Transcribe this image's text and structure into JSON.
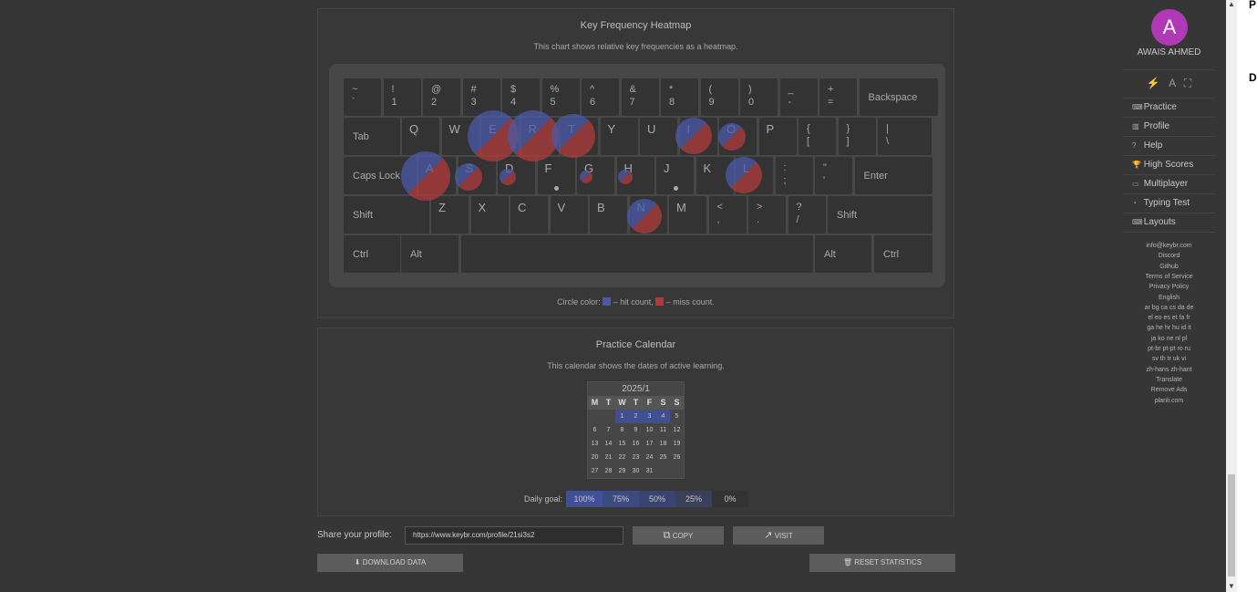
{
  "heatmap": {
    "title": "Key Frequency Heatmap",
    "description": "This chart shows relative key frequencies as a heatmap.",
    "legend_prefix": "Circle color:",
    "legend_hit": "– hit count,",
    "legend_miss": "– miss count.",
    "hit_color": "#4a5aa8",
    "miss_color": "#b03a3a"
  },
  "keyboard": {
    "row1": [
      {
        "top": "~",
        "bottom": "`"
      },
      {
        "top": "!",
        "bottom": "1"
      },
      {
        "top": "@",
        "bottom": "2"
      },
      {
        "top": "#",
        "bottom": "3"
      },
      {
        "top": "$",
        "bottom": "4"
      },
      {
        "top": "%",
        "bottom": "5"
      },
      {
        "top": "^",
        "bottom": "6"
      },
      {
        "top": "&",
        "bottom": "7"
      },
      {
        "top": "*",
        "bottom": "8"
      },
      {
        "top": "(",
        "bottom": "9"
      },
      {
        "top": ")",
        "bottom": "0"
      },
      {
        "top": "_",
        "bottom": "-"
      },
      {
        "top": "+",
        "bottom": "="
      }
    ],
    "backspace": "Backspace",
    "tab": "Tab",
    "row2": [
      "Q",
      "W",
      "E",
      "R",
      "T",
      "Y",
      "U",
      "I",
      "O",
      "P"
    ],
    "row2_sym": [
      {
        "top": "{",
        "bottom": "["
      },
      {
        "top": "}",
        "bottom": "]"
      },
      {
        "top": "|",
        "bottom": "\\"
      }
    ],
    "capslock": "Caps Lock",
    "row3": [
      "A",
      "S",
      "D",
      "F",
      "G",
      "H",
      "J",
      "K",
      "L"
    ],
    "row3_sym": [
      {
        "top": ":",
        "bottom": ";"
      },
      {
        "top": "\"",
        "bottom": "'"
      }
    ],
    "enter": "Enter",
    "shift": "Shift",
    "row4": [
      "Z",
      "X",
      "C",
      "V",
      "B",
      "N",
      "M"
    ],
    "row4_sym": [
      {
        "top": "<",
        "bottom": ","
      },
      {
        "top": ">",
        "bottom": "."
      },
      {
        "top": "?",
        "bottom": "/"
      }
    ],
    "ctrl": "Ctrl",
    "alt": "Alt"
  },
  "calendar": {
    "title": "Practice Calendar",
    "description": "This calendar shows the dates of active learning.",
    "month": "2025/1",
    "weekdays": [
      "M",
      "T",
      "W",
      "T",
      "F",
      "S",
      "S"
    ],
    "weeks": [
      [
        "",
        "",
        "1",
        "2",
        "3",
        "4",
        "5"
      ],
      [
        "6",
        "7",
        "8",
        "9",
        "10",
        "11",
        "12"
      ],
      [
        "13",
        "14",
        "15",
        "16",
        "17",
        "18",
        "19"
      ],
      [
        "20",
        "21",
        "22",
        "23",
        "24",
        "25",
        "26"
      ],
      [
        "27",
        "28",
        "29",
        "30",
        "31",
        "",
        ""
      ]
    ],
    "active_days": [
      "1",
      "2",
      "3",
      "4"
    ],
    "goal_label": "Daily goal:",
    "goal_levels": [
      "100%",
      "75%",
      "50%",
      "25%",
      "0%"
    ]
  },
  "share": {
    "label": "Share your profile:",
    "url": "https://www.keybr.com/profile/21si3s2",
    "copy": "COPY",
    "visit": "VISIT",
    "download": "DOWNLOAD DATA",
    "reset": "RESET STATISTICS"
  },
  "sidebar": {
    "avatar_letter": "A",
    "user_name": "AWAIS AHMED",
    "nav": [
      {
        "label": "Practice",
        "icon": "keyboard-icon"
      },
      {
        "label": "Profile",
        "icon": "chart-icon"
      },
      {
        "label": "Help",
        "icon": "help-icon"
      },
      {
        "label": "High Scores",
        "icon": "trophy-icon"
      },
      {
        "label": "Multiplayer",
        "icon": "car-icon"
      },
      {
        "label": "Typing Test",
        "icon": "gauge-icon"
      },
      {
        "label": "Layouts",
        "icon": "keyboard-icon"
      }
    ],
    "footer": [
      "info@keybr.com",
      "Discord",
      "Github",
      "Terms of Service",
      "Privacy Policy",
      "English",
      "ar bg ca cs da de",
      "el eo es et fa fr",
      "ga he hr hu id it",
      "ja ko ne nl pl",
      "pt-br pt-pt ro ru",
      "sv th tr uk vi",
      "zh-hans zh-hant",
      "Translate",
      "Remove Ads",
      "planli.com"
    ]
  },
  "right_edge": {
    "p": "P",
    "d": "D"
  }
}
